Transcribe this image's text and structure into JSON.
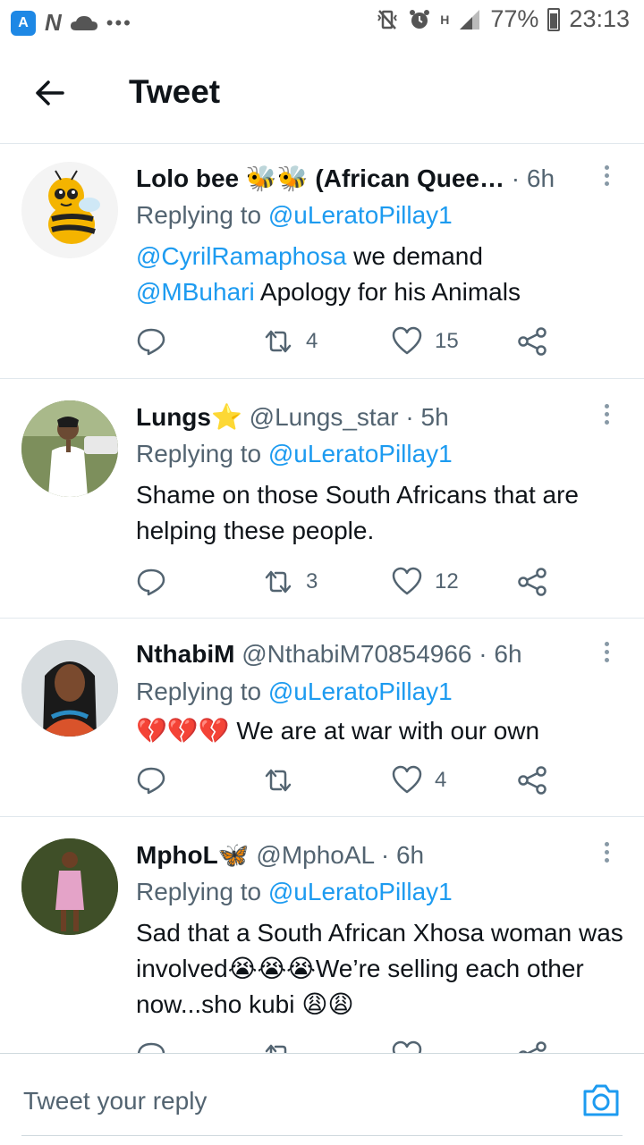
{
  "status_bar": {
    "battery": "77%",
    "time": "23:13",
    "signal_label": "H"
  },
  "header": {
    "title": "Tweet",
    "back_icon": "arrow-left-icon"
  },
  "tweets": [
    {
      "name": "Lolo bee 🐝🐝 (African Quee…",
      "handle": "",
      "time": "6h",
      "replying_prefix": "Replying to ",
      "replying_to": "@uLeratoPillay1",
      "body_parts": [
        {
          "mention": "@CyrilRamaphosa",
          "text": " we demand"
        },
        {
          "mention": "@MBuhari",
          "text": " Apology for his Animals"
        }
      ],
      "replies": "",
      "retweets": "4",
      "likes": "15"
    },
    {
      "name": "Lungs⭐",
      "handle": "@Lungs_star",
      "time": "5h",
      "replying_prefix": "Replying to ",
      "replying_to": "@uLeratoPillay1",
      "body": "Shame on those South Africans that are helping these people.",
      "replies": "",
      "retweets": "3",
      "likes": "12"
    },
    {
      "name": "NthabiM",
      "handle": "@NthabiM70854966",
      "time": "6h",
      "replying_prefix": "Replying to ",
      "replying_to": "@uLeratoPillay1",
      "body": "💔💔💔 We are at war with our own",
      "replies": "",
      "retweets": "",
      "likes": "4"
    },
    {
      "name": "MphoL🦋",
      "handle": "@MphoAL",
      "time": "6h",
      "replying_prefix": "Replying to ",
      "replying_to": "@uLeratoPillay1",
      "body": "Sad that a South African Xhosa woman was involved😭😭😭We’re selling each other now...sho kubi 😩😩",
      "replies": "",
      "retweets": "",
      "likes": ""
    }
  ],
  "reply_bar": {
    "placeholder": "Tweet your reply",
    "camera_icon": "camera-icon"
  },
  "colors": {
    "link": "#1d9bf0",
    "muted": "#536471",
    "text": "#0f1419",
    "divider": "#e1e8ed"
  }
}
